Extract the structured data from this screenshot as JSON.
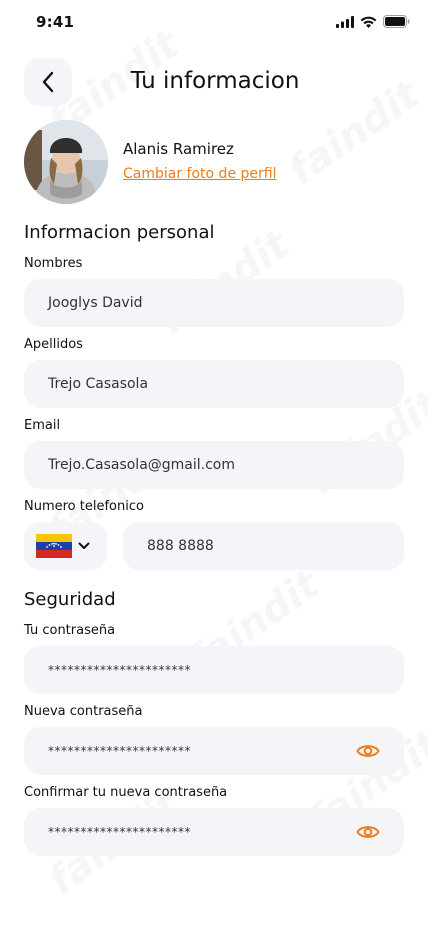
{
  "status_bar": {
    "time": "9:41"
  },
  "header": {
    "title": "Tu informacion",
    "back_icon": "chevron-left-icon"
  },
  "profile": {
    "name": "Alanis Ramirez",
    "change_photo_link": "Cambiar foto de perfil"
  },
  "personal_info": {
    "section_title": "Informacion personal",
    "first_name": {
      "label": "Nombres",
      "value": "Jooglys David"
    },
    "last_name": {
      "label": "Apellidos",
      "value": "Trejo Casasola"
    },
    "email": {
      "label": "Email",
      "value": "Trejo.Casasola@gmail.com"
    },
    "phone": {
      "label": "Numero telefonico",
      "value": "888 8888",
      "country_flag": "venezuela-flag-icon"
    }
  },
  "security": {
    "section_title": "Seguridad",
    "current_password": {
      "label": "Tu contraseña",
      "value": "**********************"
    },
    "new_password": {
      "label": "Nueva contraseña",
      "value": "**********************"
    },
    "confirm_password": {
      "label": "Confirmar tu nueva contraseña",
      "value": "**********************"
    }
  },
  "watermark": "faindit",
  "colors": {
    "accent": "#f07c1a",
    "field_bg": "#f4f5f9"
  }
}
